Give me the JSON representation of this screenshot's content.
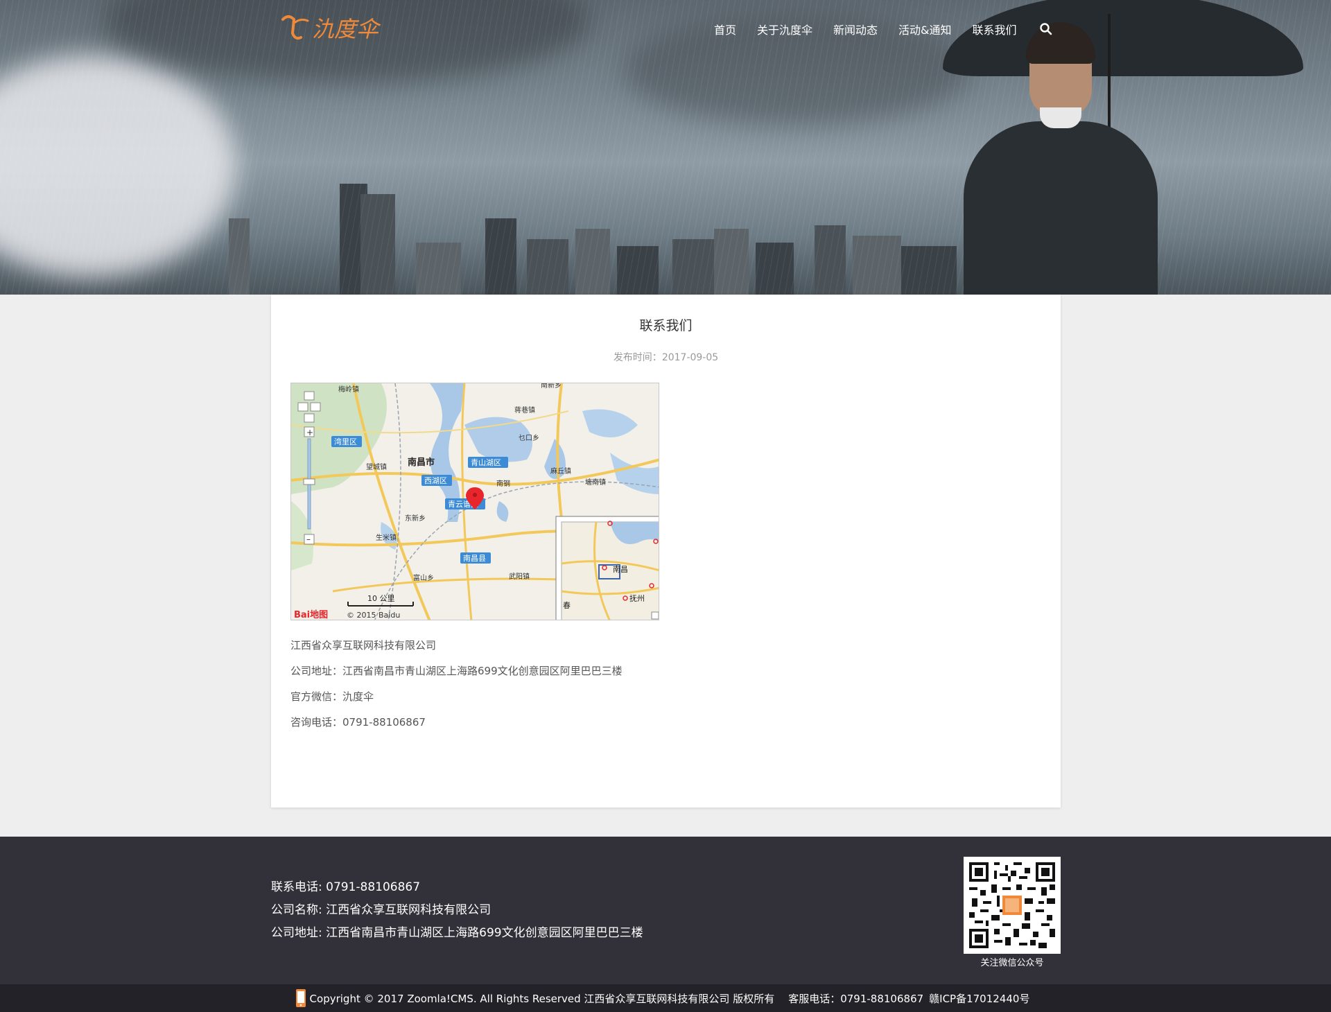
{
  "brand": {
    "logo_text": "氿度伞"
  },
  "nav": {
    "items": [
      {
        "label": "首页"
      },
      {
        "label": "关于氿度伞"
      },
      {
        "label": "新闻动态"
      },
      {
        "label": "活动&通知"
      },
      {
        "label": "联系我们"
      }
    ],
    "search_icon": "search-icon"
  },
  "article": {
    "title": "联系我们",
    "publish_label": "发布时间：",
    "publish_date": "2017-09-05",
    "company": "江西省众享互联网科技有限公司",
    "address": "公司地址：江西省南昌市青山湖区上海路699文化创意园区阿里巴巴三楼",
    "wechat": "官方微信：氿度伞",
    "phone": "咨询电话：0791-88106867"
  },
  "map": {
    "labels": {
      "meiling": "梅岭镇",
      "nanxin": "南新乡",
      "jiangwei": "蒋巷镇",
      "wanli": "湾里区",
      "wangcheng": "望城镇",
      "nanchang_city": "南昌市",
      "qingshanhu": "青山湖区",
      "xihu": "西湖区",
      "qingyunpu": "青云谱区",
      "nanchang_county": "南昌县",
      "dongxin": "东新乡",
      "shengmi": "生米镇",
      "fushan": "富山乡",
      "wuyang": "武阳镇",
      "luokou": "乜口乡",
      "tanghu": "塘南镇",
      "mali": "麻丘镇",
      "nangang": "南钢",
      "scale": "10 公里",
      "copyright": "© 2015 Baidu",
      "logo": "Bai地图",
      "mini_nanchang": "南昌",
      "mini_fuzhou": "抚州",
      "mini_chun": "春"
    }
  },
  "footer": {
    "phone": "联系电话: 0791-88106867",
    "company": "公司名称: 江西省众享互联网科技有限公司",
    "address": "公司地址: 江西省南昌市青山湖区上海路699文化创意园区阿里巴巴三楼",
    "qr_caption": "关注微信公众号"
  },
  "bottom_bar": {
    "copyright": "Copyright © 2017 Zoomla!CMS. All Rights Reserved 江西省众享互联网科技有限公司 版权所有",
    "service_phone": "客服电话：0791-88106867",
    "icp": "赣ICP备17012440号"
  },
  "colors": {
    "brand_orange": "#f08a3a",
    "footer_bg": "#32313a",
    "bottom_bar_bg": "#232228",
    "map_marker": "#e8262b"
  }
}
